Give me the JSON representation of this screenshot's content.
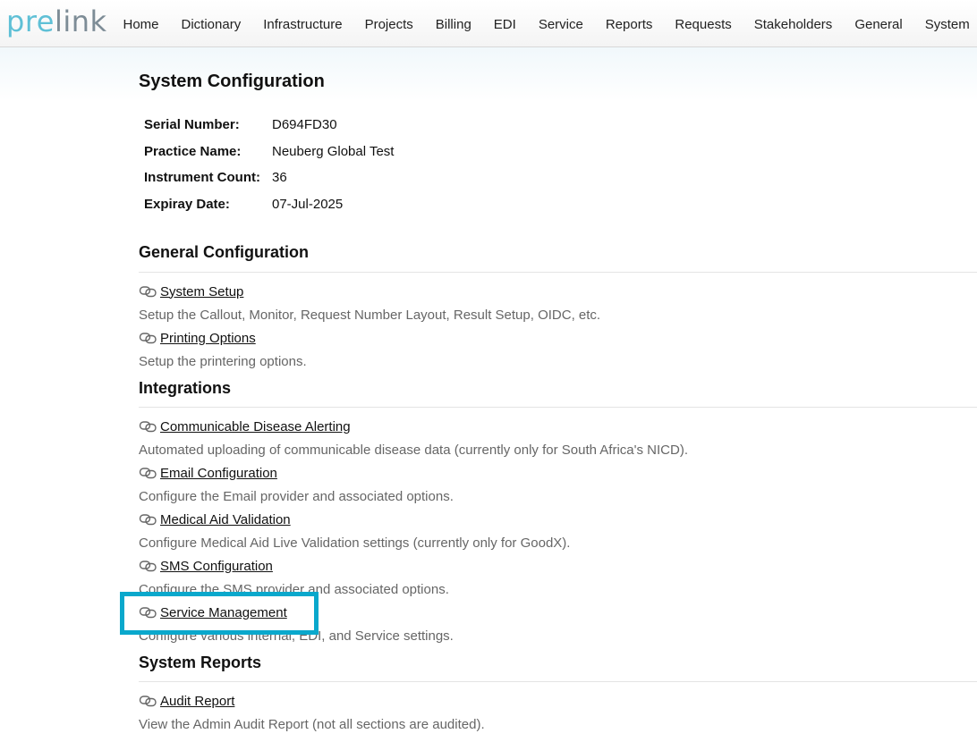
{
  "app": {
    "logo_part1": "pre",
    "logo_part2": "link",
    "nav": [
      "Home",
      "Dictionary",
      "Infrastructure",
      "Projects",
      "Billing",
      "EDI",
      "Service",
      "Reports",
      "Requests",
      "Stakeholders",
      "General",
      "System"
    ]
  },
  "page": {
    "title": "System Configuration",
    "info": [
      {
        "label": "Serial Number:",
        "value": "D694FD30"
      },
      {
        "label": "Practice Name:",
        "value": "Neuberg Global Test"
      },
      {
        "label": "Instrument Count:",
        "value": "36"
      },
      {
        "label": "Expiray Date:",
        "value": "07-Jul-2025"
      }
    ]
  },
  "sections": {
    "general": {
      "title": "General Configuration",
      "links": [
        {
          "label": "System Setup",
          "desc": "Setup the Callout, Monitor, Request Number Layout, Result Setup, OIDC, etc."
        },
        {
          "label": "Printing Options",
          "desc": "Setup the printering options."
        }
      ]
    },
    "integrations": {
      "title": "Integrations",
      "links": [
        {
          "label": "Communicable Disease Alerting",
          "desc": "Automated uploading of communicable disease data (currently only for South Africa's NICD)."
        },
        {
          "label": "Email Configuration",
          "desc": "Configure the Email provider and associated options."
        },
        {
          "label": "Medical Aid Validation",
          "desc": "Configure Medical Aid Live Validation settings (currently only for GoodX)."
        },
        {
          "label": "SMS Configuration",
          "desc": "Configure the SMS provider and associated options."
        },
        {
          "label": "Service Management",
          "desc": "Configure various internal, EDI, and Service settings."
        }
      ]
    },
    "reports": {
      "title": "System Reports",
      "links": [
        {
          "label": "Audit Report",
          "desc": "View the Admin Audit Report (not all sections are audited)."
        }
      ]
    }
  },
  "colors": {
    "highlight": "#0aa8cc",
    "logo_accent": "#5fc0d6",
    "logo_gray": "#7d8c96"
  }
}
